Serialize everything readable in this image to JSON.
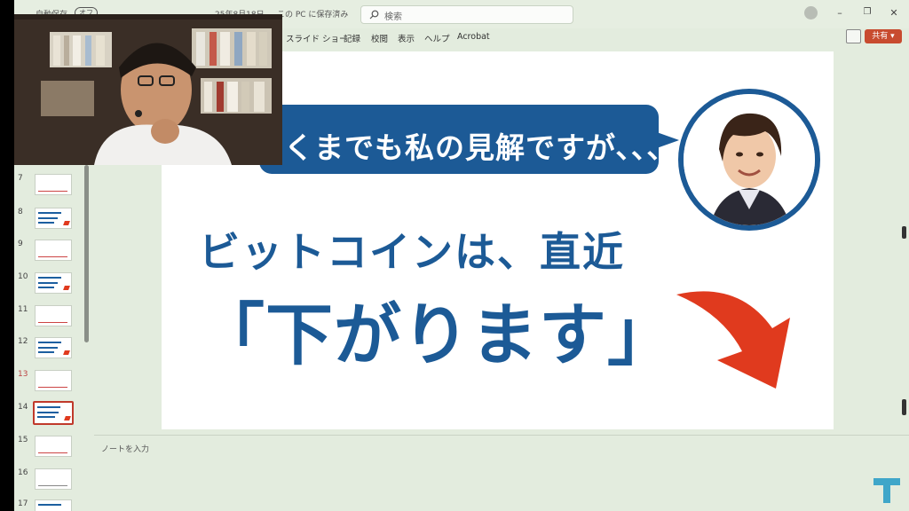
{
  "titlebar": {
    "autosave_label": "自動保存",
    "autosave_state": "オフ",
    "doc_title": "25年8月18日 ...",
    "save_status": "この PC に保存済み",
    "search_placeholder": "検索",
    "minimize": "–",
    "restore": "❐",
    "close": "✕"
  },
  "menu": {
    "items": [
      "スライド ショー",
      "記録",
      "校閲",
      "表示",
      "ヘルプ",
      "Acrobat"
    ],
    "share_label": "共有"
  },
  "thumbnails": {
    "numbers": [
      "7",
      "8",
      "9",
      "10",
      "11",
      "12",
      "13",
      "14",
      "15",
      "16",
      "17"
    ],
    "selected": "14"
  },
  "slide": {
    "bubble_text": "くまでも私の見解ですが、、、",
    "headline_line1": "ビットコインは、直近",
    "headline_line2": "「下がります」",
    "colors": {
      "accent_blue": "#1c5a96",
      "arrow_red": "#e03a1e"
    }
  },
  "notes": {
    "placeholder": "ノートを入力"
  }
}
